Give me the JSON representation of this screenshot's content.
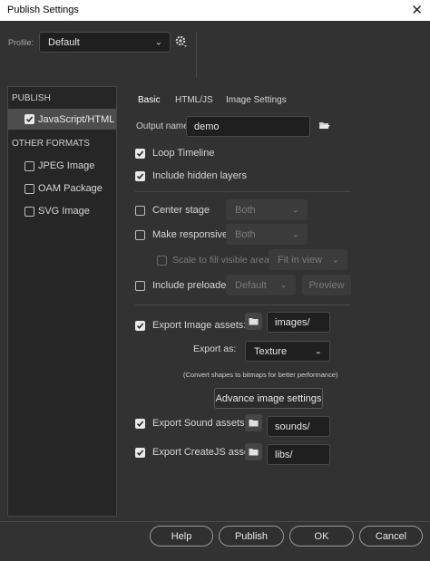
{
  "window": {
    "title": "Publish Settings",
    "close_glyph": "✕"
  },
  "profile": {
    "label": "Profile:",
    "value": "Default",
    "options_icon": "gear-icon"
  },
  "sidebar": {
    "publish_header": "PUBLISH",
    "javascript_html": "JavaScript/HTML",
    "other_header": "OTHER FORMATS",
    "items": [
      {
        "label": "JPEG Image",
        "checked": false
      },
      {
        "label": "OAM Package",
        "checked": false
      },
      {
        "label": "SVG Image",
        "checked": false
      }
    ]
  },
  "tabs": [
    "Basic",
    "HTML/JS",
    "Image Settings"
  ],
  "basic": {
    "output_label": "Output name:",
    "output_value": "demo",
    "loop_timeline": "Loop Timeline",
    "include_hidden": "Include hidden layers",
    "center_stage": "Center stage",
    "center_value": "Both",
    "make_responsive": "Make responsive",
    "responsive_value": "Both",
    "scale_fill": "Scale to fill visible area",
    "scale_value": "Fit in view",
    "include_preloader": "Include preloader",
    "preloader_value": "Default",
    "preview": "Preview",
    "export_image": "Export Image assets:",
    "image_path": "images/",
    "export_as_label": "Export as:",
    "export_as_value": "Texture",
    "convert_note": "(Convert shapes to bitmaps for better performance)",
    "advanced": "Advance image settings",
    "export_sound": "Export Sound assets:",
    "sound_path": "sounds/",
    "export_createjs": "Export CreateJS assets:",
    "createjs_path": "libs/"
  },
  "footer": {
    "help": "Help",
    "publish": "Publish",
    "ok": "OK",
    "cancel": "Cancel"
  }
}
